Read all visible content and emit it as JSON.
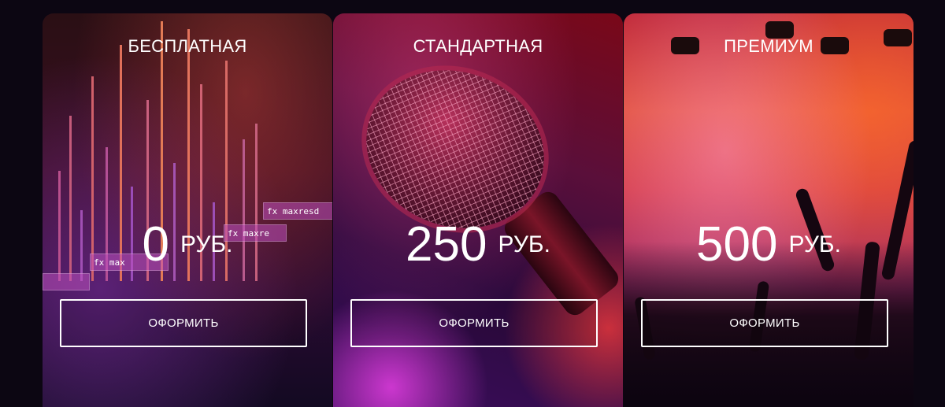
{
  "plans": [
    {
      "id": "free",
      "title": "БЕСПЛАТНАЯ",
      "amount": "0",
      "currency": "РУБ.",
      "cta": "ОФОРМИТЬ"
    },
    {
      "id": "standard",
      "title": "СТАНДАРТНАЯ",
      "amount": "250",
      "currency": "РУБ.",
      "cta": "ОФОРМИТЬ"
    },
    {
      "id": "premium",
      "title": "ПРЕМИУМ",
      "amount": "500",
      "currency": "РУБ.",
      "cta": "ОФОРМИТЬ"
    }
  ],
  "colors": {
    "page_background": "#0c0612",
    "text": "#ffffff"
  }
}
